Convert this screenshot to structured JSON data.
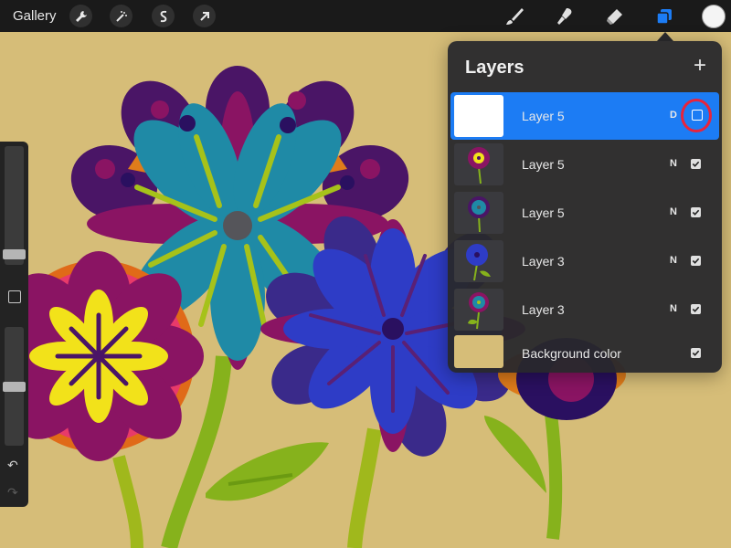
{
  "topbar": {
    "gallery_label": "Gallery",
    "left_tools": [
      "wrench-icon",
      "magic-wand-icon",
      "selection-icon",
      "transform-arrow-icon"
    ],
    "right_tools": [
      "brush-icon",
      "smudge-icon",
      "eraser-icon",
      "layers-icon"
    ],
    "current_color": "#f4f4f4",
    "active_tool_color": "#1c7cf4"
  },
  "layers": {
    "title": "Layers",
    "add_label": "+",
    "items": [
      {
        "name": "Layer 5",
        "blend": "D",
        "visible": false,
        "selected": true
      },
      {
        "name": "Layer 5",
        "blend": "N",
        "visible": true,
        "selected": false
      },
      {
        "name": "Layer 5",
        "blend": "N",
        "visible": true,
        "selected": false
      },
      {
        "name": "Layer 3",
        "blend": "N",
        "visible": true,
        "selected": false
      },
      {
        "name": "Layer 3",
        "blend": "N",
        "visible": true,
        "selected": false
      },
      {
        "name": "Background color",
        "blend": "",
        "visible": true,
        "selected": false
      }
    ]
  },
  "sidebar": {
    "brush_size_level": 0.25,
    "opacity_level": 0.5
  },
  "colors": {
    "canvas_background": "#d6bd78",
    "selection_blue": "#1c7cf4",
    "highlight_red": "#e8243c"
  }
}
